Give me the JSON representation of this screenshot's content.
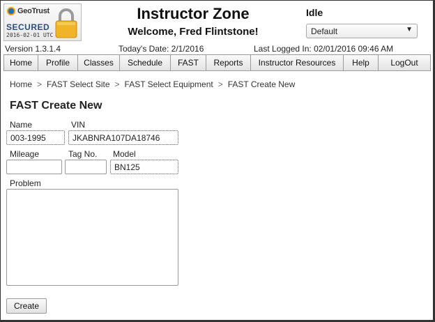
{
  "seal": {
    "brand": "GeoTrust",
    "secured": "SECURED",
    "date": "2016-02-01 UTC",
    "icon": "padlock-icon"
  },
  "header": {
    "title": "Instructor Zone",
    "welcome": "Welcome,  Fred Flintstone!",
    "status": "Idle",
    "select_value": "Default"
  },
  "info": {
    "version": "Version 1.3.1.4",
    "today": "Today's Date:  2/1/2016",
    "last_login": "Last Logged In:  02/01/2016 09:46 AM"
  },
  "nav": {
    "items": [
      "Home",
      "Profile",
      "Classes",
      "Schedule",
      "FAST",
      "Reports",
      "Instructor Resources",
      "Help",
      "LogOut"
    ]
  },
  "breadcrumb": {
    "items": [
      "Home",
      "FAST Select Site",
      "FAST Select Equipment",
      "FAST Create New"
    ],
    "separator": ">"
  },
  "form": {
    "title": "FAST Create New",
    "name_label": "Name",
    "name_value": "003-1995",
    "vin_label": "VIN",
    "vin_value": "JKABNRA107DA18746",
    "mileage_label": "Mileage",
    "mileage_value": "",
    "tag_label": "Tag No.",
    "tag_value": "",
    "model_label": "Model",
    "model_value": "BN125",
    "problem_label": "Problem",
    "problem_value": "",
    "create_label": "Create"
  }
}
